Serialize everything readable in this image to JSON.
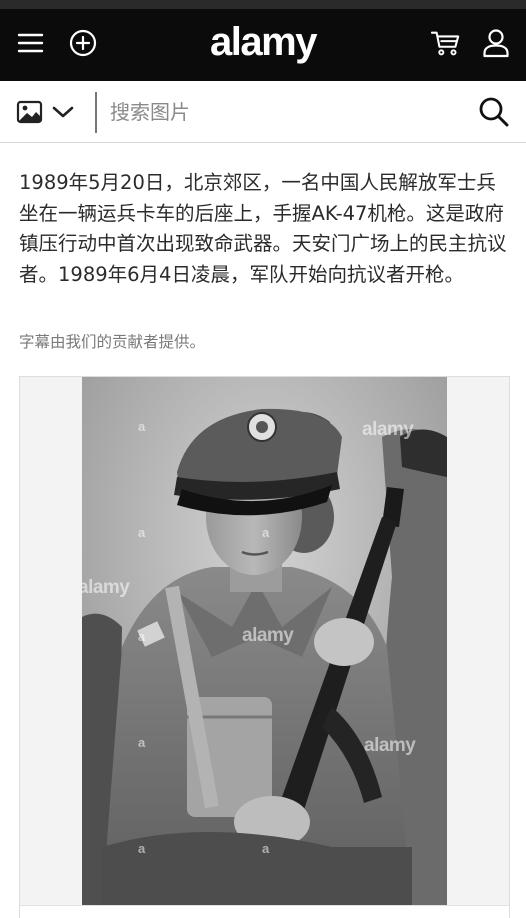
{
  "header": {
    "logo_text": "alamy",
    "menu_icon": "menu-icon",
    "add_icon": "plus-circle-icon",
    "cart_icon": "cart-icon",
    "account_icon": "user-icon"
  },
  "search": {
    "type_icon": "image-icon",
    "dropdown_icon": "chevron-down-icon",
    "placeholder": "搜索图片",
    "value": "",
    "search_icon": "search-icon"
  },
  "description": "1989年5月20日，北京郊区，一名中国人民解放军士兵坐在一辆运兵卡车的后座上，手握AK-47机枪。这是政府镇压行动中首次出现致命武器。天安门广场上的民主抗议者。1989年6月4日凌晨，军队开始向抗议者开枪。",
  "caption_credit": "字幕由我们的贡献者提供。",
  "image": {
    "watermark": "alamy",
    "watermark_short": "a"
  },
  "colors": {
    "header_bg": "#0b0b0b",
    "text": "#2b2b2b",
    "muted": "#7a7a7a"
  }
}
